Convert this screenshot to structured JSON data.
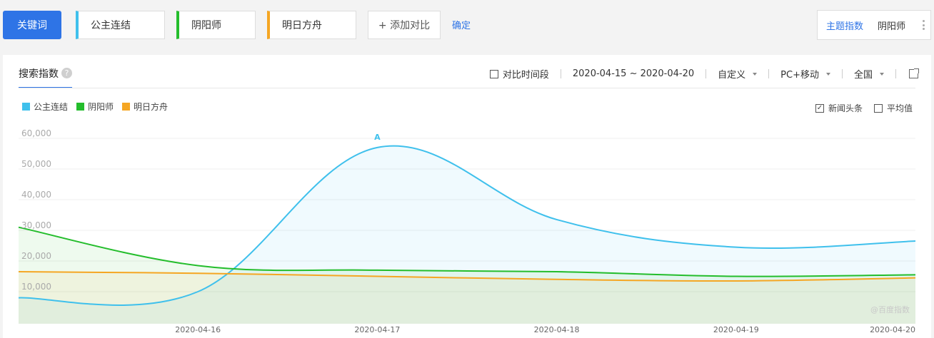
{
  "toolbar": {
    "keyword_label": "关键词",
    "keywords": [
      {
        "label": "公主连结",
        "color": "#3fc0ec"
      },
      {
        "label": "阴阳师",
        "color": "#24bd2c"
      },
      {
        "label": "明日方舟",
        "color": "#f5a623"
      }
    ],
    "add_label": "+ 添加对比",
    "confirm_label": "确定",
    "theme_index_label": "主题指数",
    "theme_keyword": "阴阳师"
  },
  "panel": {
    "tab_label": "搜索指数",
    "help_icon": "?",
    "compare_period_label": "对比时间段",
    "date_range": "2020-04-15 ~ 2020-04-20",
    "custom_label": "自定义",
    "device_label": "PC+移动",
    "region_label": "全国",
    "news_headline_label": "新闻头条",
    "news_headline_checked": true,
    "average_label": "平均值",
    "average_checked": false,
    "watermark": "@百度指数"
  },
  "chart_data": {
    "type": "area",
    "x": [
      "2020-04-15",
      "2020-04-16",
      "2020-04-17",
      "2020-04-18",
      "2020-04-19",
      "2020-04-20"
    ],
    "xticks": [
      "2020-04-16",
      "2020-04-17",
      "2020-04-18",
      "2020-04-19",
      "2020-04-20"
    ],
    "ylim": [
      0,
      60000
    ],
    "yticks": [
      "10,000",
      "20,000",
      "30,000",
      "40,000",
      "50,000",
      "60,000"
    ],
    "yvalues": [
      10000,
      20000,
      30000,
      40000,
      50000,
      60000
    ],
    "grid": true,
    "legend": "top-left",
    "series": [
      {
        "name": "公主连结",
        "color": "#3fc0ec",
        "values": [
          8000,
          10000,
          57000,
          33500,
          24500,
          26500
        ]
      },
      {
        "name": "阴阳师",
        "color": "#24bd2c",
        "values": [
          31000,
          18500,
          17000,
          16500,
          15000,
          15500
        ]
      },
      {
        "name": "明日方舟",
        "color": "#f5a623",
        "values": [
          16500,
          16000,
          15000,
          14000,
          13500,
          14500
        ]
      }
    ],
    "annotations": [
      {
        "label": "A",
        "x": "2020-04-17",
        "value": 57000
      }
    ]
  }
}
